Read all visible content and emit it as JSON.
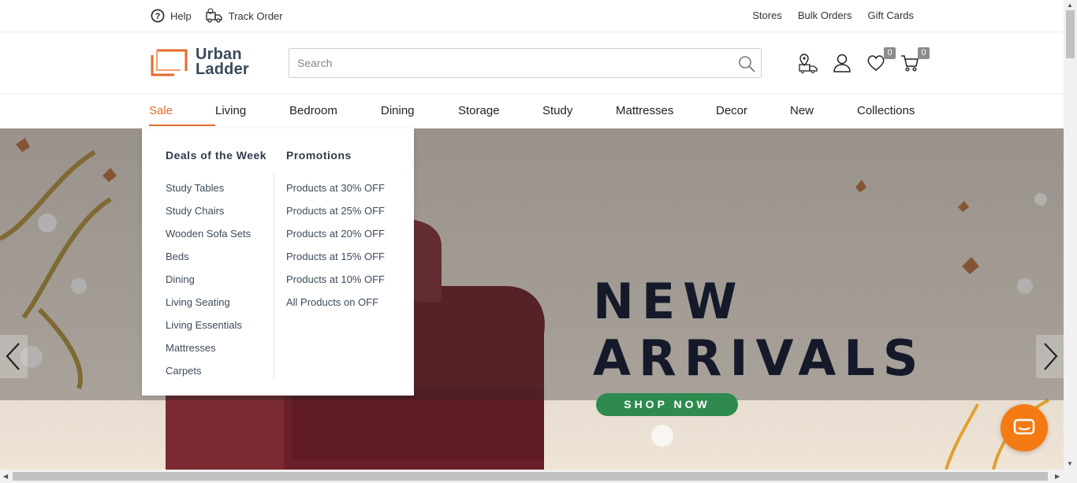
{
  "topbar": {
    "help": "Help",
    "track_order": "Track Order",
    "right_links": [
      "Stores",
      "Bulk Orders",
      "Gift Cards"
    ]
  },
  "logo": {
    "line1": "Urban",
    "line2": "Ladder"
  },
  "search": {
    "placeholder": "Search",
    "value": ""
  },
  "header_icons": {
    "store_icon": "store-locator-icon",
    "user_icon": "user-icon",
    "wishlist_count": "0",
    "cart_count": "0"
  },
  "nav": {
    "items": [
      "Sale",
      "Living",
      "Bedroom",
      "Dining",
      "Storage",
      "Study",
      "Mattresses",
      "Decor",
      "New",
      "Collections"
    ],
    "active": "Sale"
  },
  "menu": {
    "col1": {
      "heading": "Deals of the Week",
      "links": [
        "Study Tables",
        "Study Chairs",
        "Wooden Sofa Sets",
        "Beds",
        "Dining",
        "Living Seating",
        "Living Essentials",
        "Mattresses",
        "Carpets"
      ]
    },
    "col2": {
      "heading": "Promotions",
      "links": [
        "Products at 30% OFF",
        "Products at 25% OFF",
        "Products at 20% OFF",
        "Products at 15% OFF",
        "Products at 10% OFF",
        "All Products on OFF"
      ]
    }
  },
  "hero": {
    "title_line1": "NEW",
    "title_line2": "ARRIVALS",
    "cta": "SHOP NOW"
  },
  "colors": {
    "accent": "#e76a2d",
    "cta_green": "#2e8a4e",
    "chat_orange": "#f47b13"
  }
}
